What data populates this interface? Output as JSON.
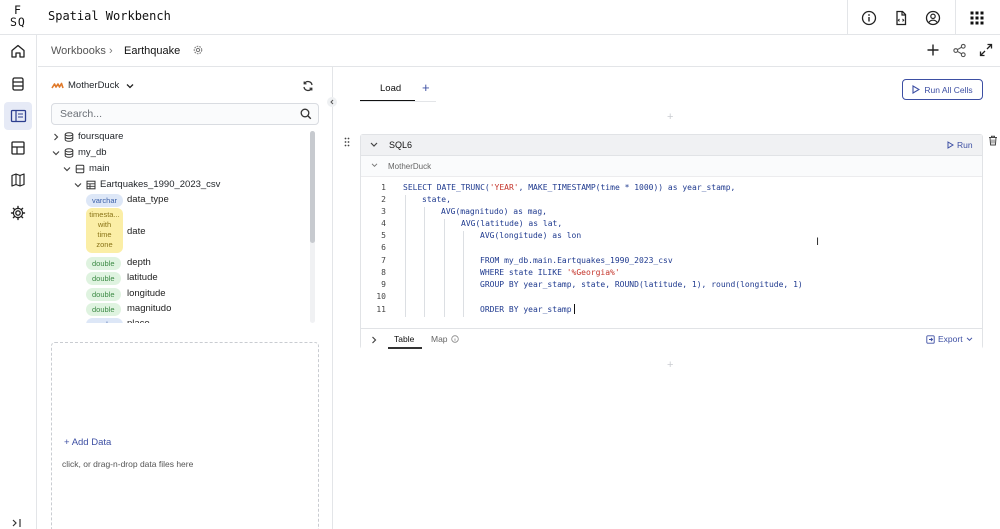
{
  "app": {
    "logo_line1": "F",
    "logo_line2": "SQ",
    "title": "Spatial Workbench"
  },
  "breadcrumb": {
    "root": "Workbooks",
    "separator": "›",
    "current": "Earthquake"
  },
  "sidebar": {
    "database": "MotherDuck",
    "search_placeholder": "Search...",
    "tree": {
      "foursquare": "foursquare",
      "my_db": "my_db",
      "main": "main",
      "table": "Eartquakes_1990_2023_csv"
    },
    "fields": [
      {
        "type": "varchar",
        "name": "data_type"
      },
      {
        "type": "timesta...\nwith\ntime\nzone",
        "name": "date"
      },
      {
        "type": "double",
        "name": "depth"
      },
      {
        "type": "double",
        "name": "latitude"
      },
      {
        "type": "double",
        "name": "longitude"
      },
      {
        "type": "double",
        "name": "magnitudo"
      },
      {
        "type": "varchar",
        "name": "place"
      }
    ],
    "add_data": "Add Data",
    "drop_hint": "click, or drag-n-drop data files here"
  },
  "main": {
    "tab": "Load",
    "run_all": "Run All Cells",
    "cell": {
      "name": "SQL6",
      "run": "Run",
      "source": "MotherDuck",
      "line_numbers": [
        "1",
        "2",
        "3",
        "4",
        "5",
        "6",
        "7",
        "8",
        "9",
        "10",
        "11"
      ],
      "footer_tabs": [
        "Table",
        "Map"
      ],
      "export": "Export"
    }
  },
  "colors": {
    "accent": "#3d4fa3",
    "string": "#c4352b",
    "keyword": "#1f3a8f"
  }
}
